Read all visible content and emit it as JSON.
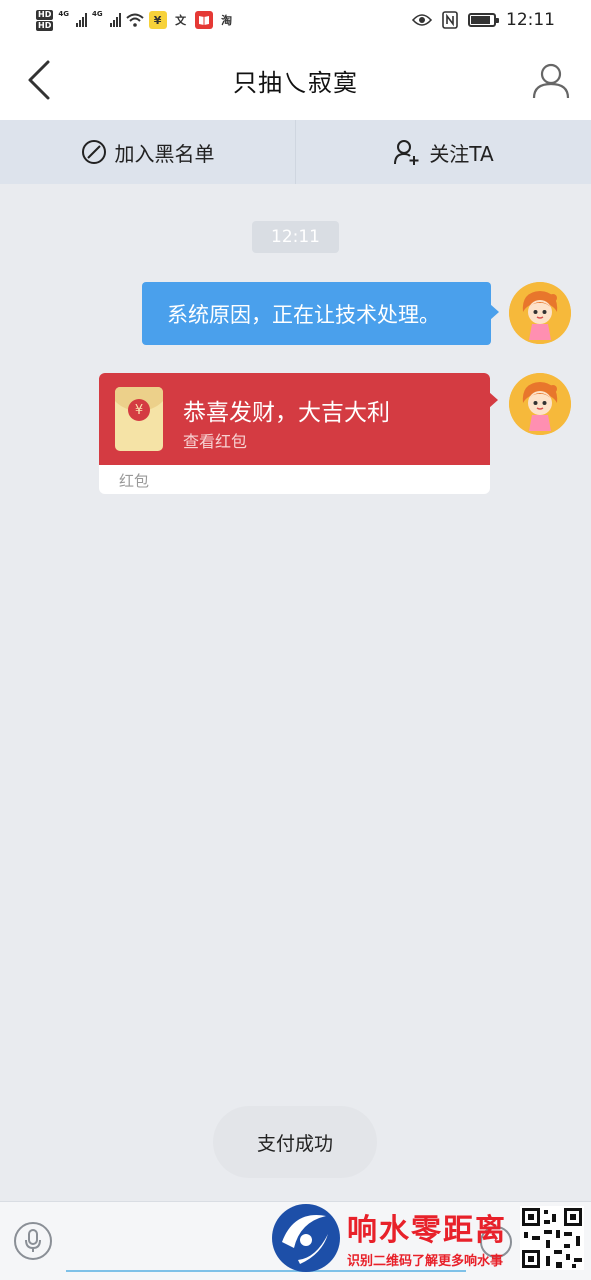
{
  "status_bar": {
    "hd1": "HD",
    "hd2": "HD",
    "net1": "4G",
    "net2": "4G",
    "icons": [
      "signal-icon",
      "wifi-icon",
      "yuan-app-icon",
      "wen-app-icon",
      "book-app-icon",
      "taobao-icon",
      "eye-icon",
      "nfc-icon",
      "battery-icon"
    ],
    "app_yuan": "¥",
    "app_wen": "文",
    "app_tao": "淘",
    "time": "12:11",
    "battery_level": 0.85
  },
  "header": {
    "title": "只抽乀寂寞",
    "back_icon": "chevron-left-icon",
    "profile_icon": "person-icon"
  },
  "actions": {
    "block_label": "加入黑名单",
    "block_icon": "block-icon",
    "follow_label": "关注TA",
    "follow_icon": "add-user-icon"
  },
  "chat": {
    "timestamp": "12:11",
    "messages": [
      {
        "type": "text",
        "text": "系统原因，正在让技术处理。"
      },
      {
        "type": "red_packet",
        "title": "恭喜发财，大吉大利",
        "subtitle": "查看红包",
        "label": "红包",
        "coin": "¥"
      }
    ]
  },
  "toast": "支付成功",
  "input": {
    "value": "",
    "mic_icon": "microphone-icon",
    "emoji_icon": "emoji-icon"
  },
  "watermark": {
    "title": "响水零距离",
    "subtitle": "识别二维码了解更多响水事"
  },
  "colors": {
    "bubble": "#4aa0ec",
    "red_packet": "#d43b42",
    "watermark": "#e8212a",
    "avatar_bg": "#f6b93b"
  }
}
